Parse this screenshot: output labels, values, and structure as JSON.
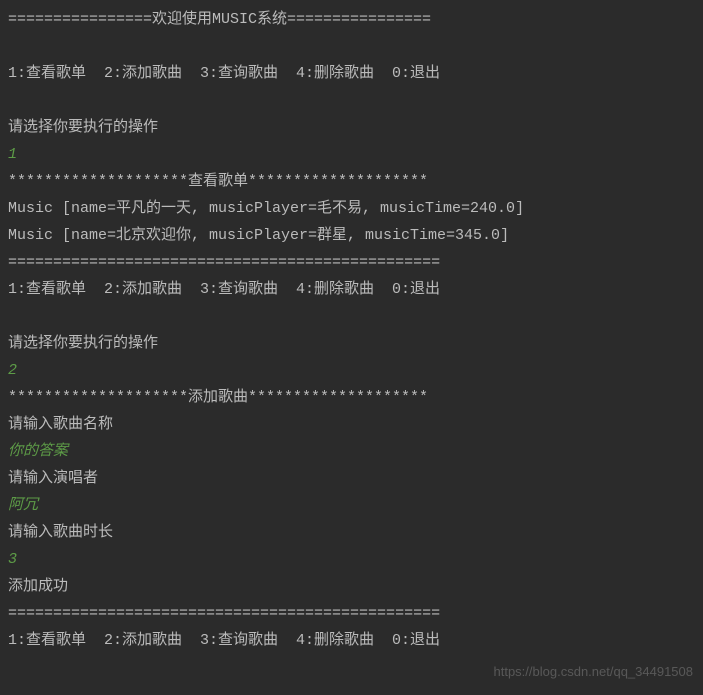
{
  "lines": {
    "l0": "================欢迎使用MUSIC系统================",
    "l1": "",
    "l2": "1:查看歌单  2:添加歌曲  3:查询歌曲  4:删除歌曲  0:退出",
    "l3": "",
    "l4": "请选择你要执行的操作",
    "l5": "1",
    "l6": "********************查看歌单********************",
    "l7": "Music [name=平凡的一天, musicPlayer=毛不易, musicTime=240.0]",
    "l8": "Music [name=北京欢迎你, musicPlayer=群星, musicTime=345.0]",
    "l9": "================================================",
    "l10": "1:查看歌单  2:添加歌曲  3:查询歌曲  4:删除歌曲  0:退出",
    "l11": "",
    "l12": "请选择你要执行的操作",
    "l13": "2",
    "l14": "********************添加歌曲********************",
    "l15": "请输入歌曲名称",
    "l16": "你的答案",
    "l17": "请输入演唱者",
    "l18": "阿冗",
    "l19": "请输入歌曲时长",
    "l20": "3",
    "l21": "添加成功",
    "l22": "================================================",
    "l23": "1:查看歌单  2:添加歌曲  3:查询歌曲  4:删除歌曲  0:退出"
  },
  "watermark": "https://blog.csdn.net/qq_34491508"
}
